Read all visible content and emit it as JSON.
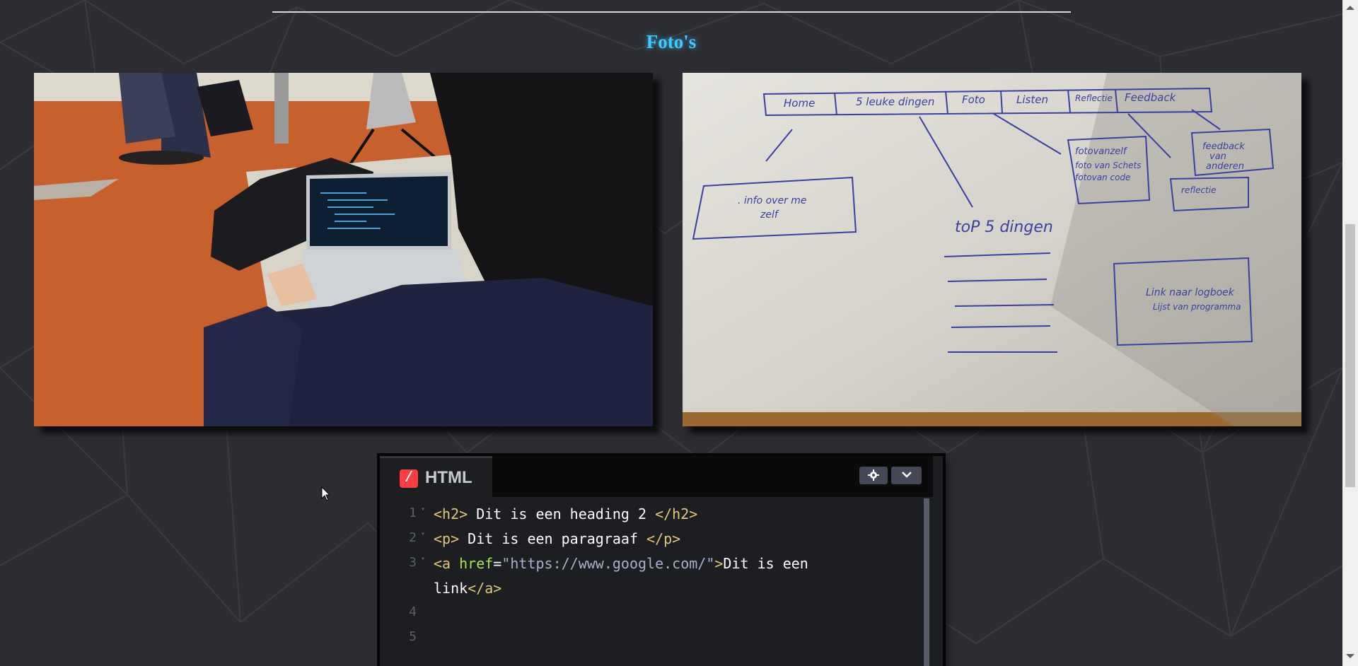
{
  "page": {
    "section_title": "Foto's"
  },
  "photos": [
    {
      "name": "student-at-laptop-photo"
    },
    {
      "name": "website-sketch-photo"
    }
  ],
  "codepen": {
    "tab_label": "HTML",
    "logo_glyph": "/",
    "settings_icon": "gear-icon",
    "collapse_icon": "chevron-down-icon",
    "lines": [
      {
        "num": "1",
        "parts": [
          [
            "tag",
            "<h2>"
          ],
          [
            "txt",
            " Dit is een heading 2 "
          ],
          [
            "tag",
            "</h2>"
          ]
        ]
      },
      {
        "num": "2",
        "parts": [
          [
            "tag",
            "<p>"
          ],
          [
            "txt",
            " Dit is een paragraaf "
          ],
          [
            "tag",
            "</p>"
          ]
        ]
      },
      {
        "num": "3",
        "parts": [
          [
            "tag",
            "<a "
          ],
          [
            "attr",
            "href"
          ],
          [
            "txt",
            "="
          ],
          [
            "str",
            "\"https://www.google.com/\""
          ],
          [
            "tag",
            ">"
          ],
          [
            "txt",
            "Dit is een"
          ]
        ]
      },
      {
        "num": "",
        "parts": [
          [
            "txt",
            "link"
          ],
          [
            "tag",
            "</a>"
          ]
        ]
      },
      {
        "num": "4",
        "parts": []
      },
      {
        "num": "5",
        "parts": []
      }
    ]
  },
  "colors": {
    "title": "#3fc9ff",
    "background": "#2b2c31",
    "codepen_logo": "#ff3c41"
  }
}
